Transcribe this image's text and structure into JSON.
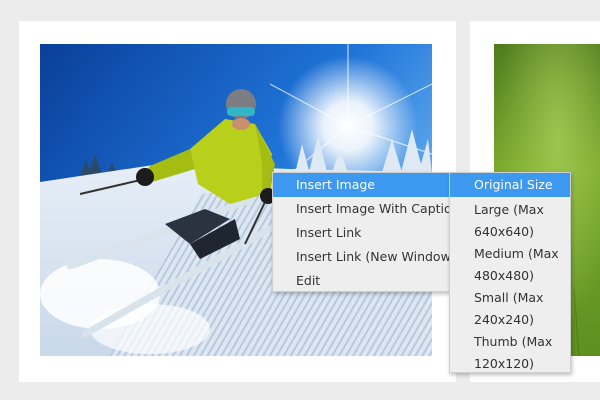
{
  "context_menu": {
    "items": [
      {
        "label": "Insert Image",
        "active": true
      },
      {
        "label": "Insert Image With Caption",
        "active": false
      },
      {
        "label": "Insert Link",
        "active": false
      },
      {
        "label": "Insert Link (New Window)",
        "active": false
      },
      {
        "label": "Edit",
        "active": false
      }
    ]
  },
  "submenu": {
    "items": [
      {
        "line1": "Original Size",
        "line2": "",
        "active": true
      },
      {
        "line1": "Large (Max",
        "line2": "640x640)",
        "active": false
      },
      {
        "line1": "Medium (Max",
        "line2": "480x480)",
        "active": false
      },
      {
        "line1": "Small (Max",
        "line2": "240x240)",
        "active": false
      },
      {
        "line1": "Thumb (Max",
        "line2": "120x120)",
        "active": false
      }
    ]
  },
  "colors": {
    "page_background": "#ececed",
    "card": "#ffffff",
    "menu_background": "#eeeeee",
    "highlight": "#3d99ef",
    "text": "#333333"
  }
}
